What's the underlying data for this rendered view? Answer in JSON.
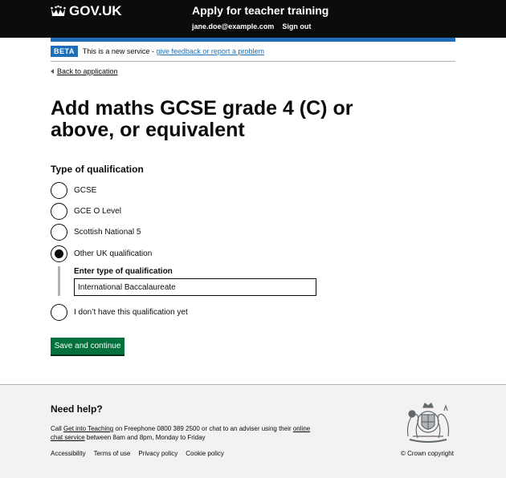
{
  "header": {
    "logo_text": "GOV.UK",
    "service_name": "Apply for teacher training",
    "nav": {
      "email": "jane.doe@example.com",
      "sign_out": "Sign out"
    }
  },
  "phase_banner": {
    "tag": "BETA",
    "text": "This is a new service - ",
    "link": "give feedback or report a problem"
  },
  "back_link": "Back to application",
  "page_title": "Add maths GCSE grade 4 (C) or above, or equivalent",
  "question": "Type of qualification",
  "options": [
    {
      "label": "GCSE",
      "selected": false
    },
    {
      "label": "GCE O Level",
      "selected": false
    },
    {
      "label": "Scottish National 5",
      "selected": false
    },
    {
      "label": "Other UK qualification",
      "selected": true
    },
    {
      "label": "I don’t have this qualification yet",
      "selected": false
    }
  ],
  "conditional": {
    "label": "Enter type of qualification",
    "value": "International Baccalaureate"
  },
  "submit_label": "Save and continue",
  "footer": {
    "heading": "Need help?",
    "help": {
      "prefix": "Call ",
      "link1": "Get into Teaching",
      "middle": " on Freephone 0800 389 2500 or chat to an adviser using their ",
      "link2": "online chat service",
      "suffix": " between 8am and 8pm, Monday to Friday"
    },
    "links": [
      "Accessibility",
      "Terms of use",
      "Privacy policy",
      "Cookie policy"
    ],
    "copyright": "© Crown copyright"
  },
  "colors": {
    "header_bg": "#0b0c0c",
    "brand_blue": "#1d70b8",
    "button_green": "#00703c",
    "footer_bg": "#f3f2f1"
  },
  "icons": [
    "crown-icon",
    "back-chevron-icon",
    "royal-crest-icon"
  ]
}
